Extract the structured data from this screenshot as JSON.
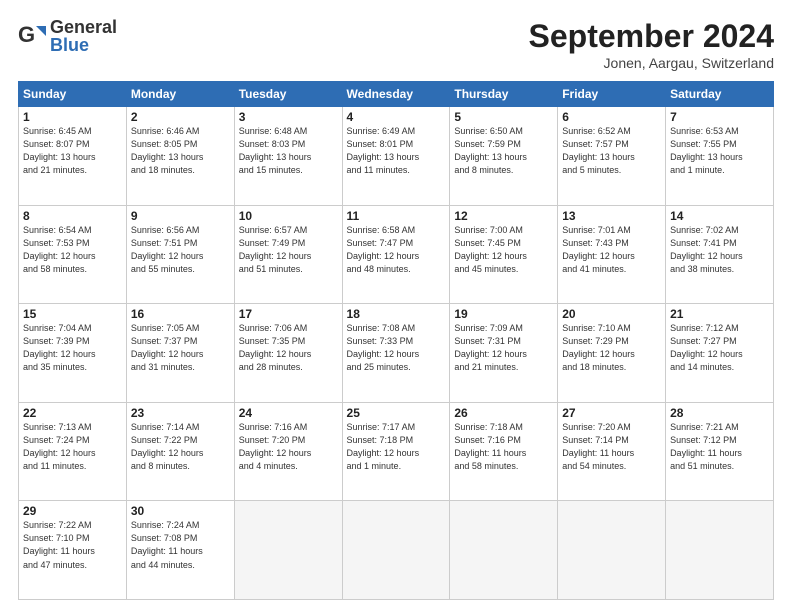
{
  "logo": {
    "general": "General",
    "blue": "Blue"
  },
  "header": {
    "month": "September 2024",
    "location": "Jonen, Aargau, Switzerland"
  },
  "weekdays": [
    "Sunday",
    "Monday",
    "Tuesday",
    "Wednesday",
    "Thursday",
    "Friday",
    "Saturday"
  ],
  "weeks": [
    [
      {
        "day": "1",
        "info": "Sunrise: 6:45 AM\nSunset: 8:07 PM\nDaylight: 13 hours\nand 21 minutes."
      },
      {
        "day": "2",
        "info": "Sunrise: 6:46 AM\nSunset: 8:05 PM\nDaylight: 13 hours\nand 18 minutes."
      },
      {
        "day": "3",
        "info": "Sunrise: 6:48 AM\nSunset: 8:03 PM\nDaylight: 13 hours\nand 15 minutes."
      },
      {
        "day": "4",
        "info": "Sunrise: 6:49 AM\nSunset: 8:01 PM\nDaylight: 13 hours\nand 11 minutes."
      },
      {
        "day": "5",
        "info": "Sunrise: 6:50 AM\nSunset: 7:59 PM\nDaylight: 13 hours\nand 8 minutes."
      },
      {
        "day": "6",
        "info": "Sunrise: 6:52 AM\nSunset: 7:57 PM\nDaylight: 13 hours\nand 5 minutes."
      },
      {
        "day": "7",
        "info": "Sunrise: 6:53 AM\nSunset: 7:55 PM\nDaylight: 13 hours\nand 1 minute."
      }
    ],
    [
      {
        "day": "8",
        "info": "Sunrise: 6:54 AM\nSunset: 7:53 PM\nDaylight: 12 hours\nand 58 minutes."
      },
      {
        "day": "9",
        "info": "Sunrise: 6:56 AM\nSunset: 7:51 PM\nDaylight: 12 hours\nand 55 minutes."
      },
      {
        "day": "10",
        "info": "Sunrise: 6:57 AM\nSunset: 7:49 PM\nDaylight: 12 hours\nand 51 minutes."
      },
      {
        "day": "11",
        "info": "Sunrise: 6:58 AM\nSunset: 7:47 PM\nDaylight: 12 hours\nand 48 minutes."
      },
      {
        "day": "12",
        "info": "Sunrise: 7:00 AM\nSunset: 7:45 PM\nDaylight: 12 hours\nand 45 minutes."
      },
      {
        "day": "13",
        "info": "Sunrise: 7:01 AM\nSunset: 7:43 PM\nDaylight: 12 hours\nand 41 minutes."
      },
      {
        "day": "14",
        "info": "Sunrise: 7:02 AM\nSunset: 7:41 PM\nDaylight: 12 hours\nand 38 minutes."
      }
    ],
    [
      {
        "day": "15",
        "info": "Sunrise: 7:04 AM\nSunset: 7:39 PM\nDaylight: 12 hours\nand 35 minutes."
      },
      {
        "day": "16",
        "info": "Sunrise: 7:05 AM\nSunset: 7:37 PM\nDaylight: 12 hours\nand 31 minutes."
      },
      {
        "day": "17",
        "info": "Sunrise: 7:06 AM\nSunset: 7:35 PM\nDaylight: 12 hours\nand 28 minutes."
      },
      {
        "day": "18",
        "info": "Sunrise: 7:08 AM\nSunset: 7:33 PM\nDaylight: 12 hours\nand 25 minutes."
      },
      {
        "day": "19",
        "info": "Sunrise: 7:09 AM\nSunset: 7:31 PM\nDaylight: 12 hours\nand 21 minutes."
      },
      {
        "day": "20",
        "info": "Sunrise: 7:10 AM\nSunset: 7:29 PM\nDaylight: 12 hours\nand 18 minutes."
      },
      {
        "day": "21",
        "info": "Sunrise: 7:12 AM\nSunset: 7:27 PM\nDaylight: 12 hours\nand 14 minutes."
      }
    ],
    [
      {
        "day": "22",
        "info": "Sunrise: 7:13 AM\nSunset: 7:24 PM\nDaylight: 12 hours\nand 11 minutes."
      },
      {
        "day": "23",
        "info": "Sunrise: 7:14 AM\nSunset: 7:22 PM\nDaylight: 12 hours\nand 8 minutes."
      },
      {
        "day": "24",
        "info": "Sunrise: 7:16 AM\nSunset: 7:20 PM\nDaylight: 12 hours\nand 4 minutes."
      },
      {
        "day": "25",
        "info": "Sunrise: 7:17 AM\nSunset: 7:18 PM\nDaylight: 12 hours\nand 1 minute."
      },
      {
        "day": "26",
        "info": "Sunrise: 7:18 AM\nSunset: 7:16 PM\nDaylight: 11 hours\nand 58 minutes."
      },
      {
        "day": "27",
        "info": "Sunrise: 7:20 AM\nSunset: 7:14 PM\nDaylight: 11 hours\nand 54 minutes."
      },
      {
        "day": "28",
        "info": "Sunrise: 7:21 AM\nSunset: 7:12 PM\nDaylight: 11 hours\nand 51 minutes."
      }
    ],
    [
      {
        "day": "29",
        "info": "Sunrise: 7:22 AM\nSunset: 7:10 PM\nDaylight: 11 hours\nand 47 minutes."
      },
      {
        "day": "30",
        "info": "Sunrise: 7:24 AM\nSunset: 7:08 PM\nDaylight: 11 hours\nand 44 minutes."
      },
      {
        "day": "",
        "info": ""
      },
      {
        "day": "",
        "info": ""
      },
      {
        "day": "",
        "info": ""
      },
      {
        "day": "",
        "info": ""
      },
      {
        "day": "",
        "info": ""
      }
    ]
  ]
}
